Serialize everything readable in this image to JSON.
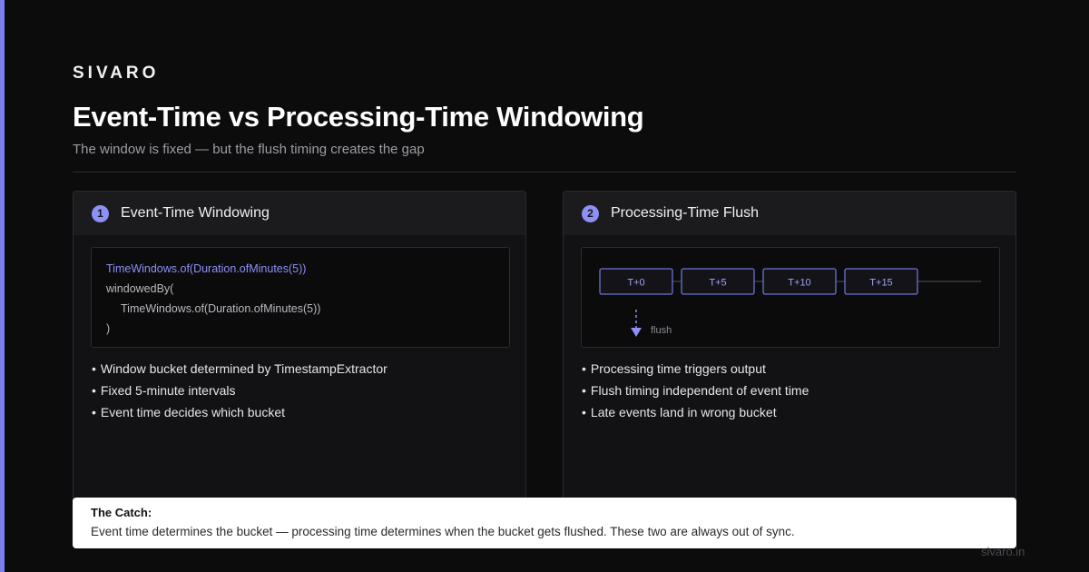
{
  "brand": "SIVARO",
  "title": "Event-Time vs Processing-Time Windowing",
  "subtitle": "The window is fixed — but the flush timing creates the gap",
  "colors": {
    "accent": "#8d90f5",
    "background": "#0c0c0d",
    "card": "#121214"
  },
  "cards": [
    {
      "number": "1",
      "title": "Event-Time Windowing",
      "code": [
        "TimeWindows.of(Duration.ofMinutes(5))",
        "windowedBy(",
        "TimeWindows.of(Duration.ofMinutes(5))",
        ")"
      ],
      "bullets": [
        "Window bucket determined by TimestampExtractor",
        "Fixed 5-minute intervals",
        "Event time decides which bucket"
      ]
    },
    {
      "number": "2",
      "title": "Processing-Time Flush",
      "timeline": {
        "windows": [
          "T+0",
          "T+5",
          "T+10",
          "T+15"
        ],
        "flush_label": "flush"
      },
      "bullets": [
        "Processing time triggers output",
        "Flush timing independent of event time",
        "Late events land in wrong bucket"
      ]
    }
  ],
  "catch": {
    "title": "The Catch:",
    "text": "Event time determines the bucket — processing time determines when the bucket gets flushed. These two are always out of sync."
  },
  "footer": "sivaro.in"
}
